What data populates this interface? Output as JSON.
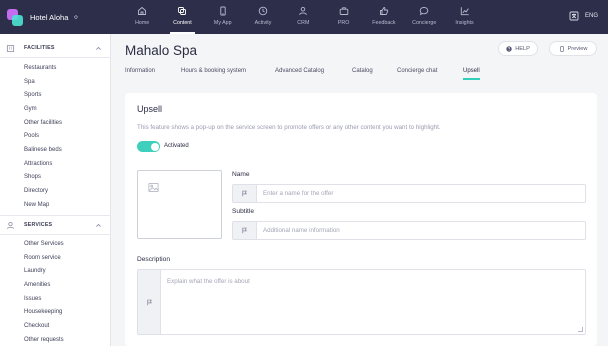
{
  "app": {
    "name": "Hotel Aloha",
    "caret": "≎"
  },
  "nav": [
    {
      "label": "Home",
      "icon": "home-icon"
    },
    {
      "label": "Content",
      "icon": "content-icon",
      "active": true
    },
    {
      "label": "My App",
      "icon": "phone-icon"
    },
    {
      "label": "Activity",
      "icon": "activity-icon"
    },
    {
      "label": "CRM",
      "icon": "users-icon"
    },
    {
      "label": "PRO",
      "icon": "briefcase-icon"
    },
    {
      "label": "Feedback",
      "icon": "thumbs-up-icon"
    },
    {
      "label": "Concierge",
      "icon": "chat-icon"
    },
    {
      "label": "Insights",
      "icon": "chart-icon"
    }
  ],
  "topbar": {
    "language": "ENG",
    "translate_icon": "translate-icon"
  },
  "sidebar": {
    "facilities": {
      "title": "FACILITIES",
      "icon": "building-icon",
      "items": [
        "Restaurants",
        "Spa",
        "Sports",
        "Gym",
        "Other facilities",
        "Pools",
        "Balinese beds",
        "Attractions",
        "Shops",
        "Directory",
        "New Map"
      ]
    },
    "services": {
      "title": "SERVICES",
      "icon": "services-icon",
      "items": [
        "Other Services",
        "Room service",
        "Laundry",
        "Amenities",
        "Issues",
        "Housekeeping",
        "Checkout",
        "Other requests"
      ]
    }
  },
  "page": {
    "title": "Mahalo Spa",
    "help_label": "HELP",
    "preview_label": "Preview",
    "tabs": [
      "Information",
      "Hours & booking system",
      "Advanced Catalog",
      "Catalog",
      "Concierge chat",
      "Upsell"
    ],
    "active_tab": "Upsell"
  },
  "upsell": {
    "title": "Upsell",
    "description": "This feature shows a pop-up on the service screen to promote offers or any other content you want to highlight.",
    "toggle_label": "Activated",
    "toggle_on": true,
    "name_label": "Name",
    "name_placeholder": "Enter a name for the offer",
    "name_value": "",
    "subtitle_label": "Subtitle",
    "subtitle_placeholder": "Additional name information",
    "subtitle_value": "",
    "description_label": "Description",
    "description_placeholder": "Explain what the offer is about",
    "description_value": ""
  },
  "colors": {
    "topbar": "#2d2f4a",
    "accent": "#3fd0bd",
    "brand_purple": "#c36cf0",
    "brand_teal": "#4be3d2"
  }
}
